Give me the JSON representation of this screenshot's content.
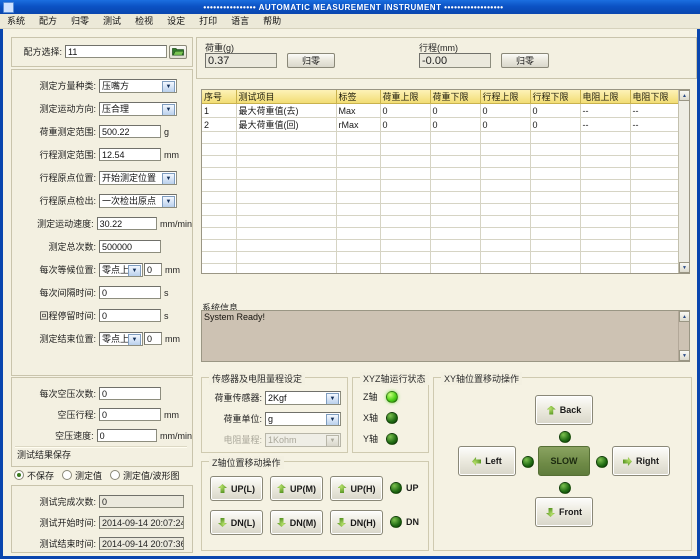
{
  "window": {
    "title": "••••••••••••••••  AUTOMATIC MEASUREMENT INSTRUMENT  ••••••••••••••••••",
    "icon": "app-icon"
  },
  "menu": {
    "items": [
      {
        "label": "系统"
      },
      {
        "label": "配方"
      },
      {
        "label": "归零"
      },
      {
        "label": "测试"
      },
      {
        "label": "检视"
      },
      {
        "label": "设定"
      },
      {
        "label": "打印"
      },
      {
        "label": "语言"
      },
      {
        "label": "帮助"
      }
    ]
  },
  "recipe": {
    "label": "配方选择:",
    "value": "11",
    "browse_icon": "folder-open-icon"
  },
  "params": {
    "rows": [
      {
        "label": "测定方量种类:",
        "value": "压嘴方",
        "type": "select",
        "unit": ""
      },
      {
        "label": "测定运动方向:",
        "value": "压合理",
        "type": "select",
        "unit": ""
      },
      {
        "label": "荷重测定范围:",
        "value": "500.22",
        "type": "input",
        "unit": "g"
      },
      {
        "label": "行程测定范围:",
        "value": "12.54",
        "type": "input",
        "unit": "mm"
      },
      {
        "label": "行程原点位置:",
        "value": "开始测定位置",
        "type": "select",
        "unit": ""
      },
      {
        "label": "行程原点检出:",
        "value": "一次检出原点",
        "type": "select",
        "unit": ""
      },
      {
        "label": "测定运动速度:",
        "value": "30.22",
        "type": "input",
        "unit": "mm/min"
      },
      {
        "label": "测定总次数:",
        "value": "500000",
        "type": "input",
        "unit": ""
      }
    ],
    "combo_rows": [
      {
        "label": "每次等候位置:",
        "select": "零点上方",
        "value": "0",
        "unit": "mm"
      },
      {
        "label": "测定结束位置:",
        "select": "零点上方",
        "value": "0",
        "unit": "mm"
      }
    ],
    "time_rows": [
      {
        "label": "每次间隔时间:",
        "value": "0",
        "unit": "s"
      },
      {
        "label": "回程停留时间:",
        "value": "0",
        "unit": "s"
      }
    ]
  },
  "air": {
    "rows": [
      {
        "label": "每次空压次数:",
        "value": "0",
        "unit": ""
      },
      {
        "label": "空压行程:",
        "value": "0",
        "unit": "mm"
      },
      {
        "label": "空压速度:",
        "value": "0",
        "unit": "mm/min"
      }
    ]
  },
  "save": {
    "title": "测试结果保存",
    "options": [
      {
        "label": "不保存",
        "selected": true
      },
      {
        "label": "测定值",
        "selected": false
      },
      {
        "label": "测定值/波形图",
        "selected": false
      }
    ]
  },
  "result": {
    "rows": [
      {
        "label": "测试完成次数:",
        "value": "0"
      },
      {
        "label": "测试开始时间:",
        "value": "2014-09-14 20:07:24"
      },
      {
        "label": "测试结束时间:",
        "value": "2014-09-14 20:07:36"
      }
    ]
  },
  "readouts": {
    "load": {
      "label": "荷重(g)",
      "value": "0.37",
      "button": "归零"
    },
    "stroke": {
      "label": "行程(mm)",
      "value": "-0.00",
      "button": "归零"
    }
  },
  "table": {
    "headers": [
      "序号",
      "测试项目",
      "标签",
      "荷重上限",
      "荷重下限",
      "行程上限",
      "行程下限",
      "电阻上限",
      "电阻下限"
    ],
    "rows": [
      [
        "1",
        "最大荷重值(去)",
        "Max",
        "0",
        "0",
        "0",
        "0",
        "--",
        "--"
      ],
      [
        "2",
        "最大荷重值(回)",
        "rMax",
        "0",
        "0",
        "0",
        "0",
        "--",
        "--"
      ]
    ],
    "empty_rows": 13,
    "scroll_up_icon": "scroll-up-icon",
    "scroll_down_icon": "scroll-down-icon"
  },
  "sysinfo": {
    "title": "系统信息",
    "text": "System Ready!",
    "scroll_up_icon": "scroll-up-icon",
    "scroll_down_icon": "scroll-down-icon"
  },
  "sensor": {
    "title": "传感器及电阻量程设定",
    "rows": [
      {
        "label": "荷重传感器:",
        "value": "2Kgf",
        "disabled": false
      },
      {
        "label": "荷重单位:",
        "value": "g",
        "disabled": false
      },
      {
        "label": "电阻量程:",
        "value": "1Kohm",
        "disabled": true
      }
    ]
  },
  "axisstatus": {
    "title": "XYZ轴运行状态",
    "items": [
      {
        "label": "Z轴",
        "state": "on"
      },
      {
        "label": "X轴",
        "state": "off"
      },
      {
        "label": "Y轴",
        "state": "off"
      }
    ]
  },
  "zaxis": {
    "title": "Z轴位置移动操作",
    "up_buttons": [
      {
        "label": "UP(L)"
      },
      {
        "label": "UP(M)"
      },
      {
        "label": "UP(H)"
      }
    ],
    "down_buttons": [
      {
        "label": "DN(L)"
      },
      {
        "label": "DN(M)"
      },
      {
        "label": "DN(H)"
      }
    ],
    "up_led": {
      "label": "UP",
      "state": "off"
    },
    "down_led": {
      "label": "DN",
      "state": "off"
    }
  },
  "xyaxis": {
    "title": "XY轴位置移动操作",
    "back": {
      "label": "Back"
    },
    "left": {
      "label": "Left"
    },
    "center": {
      "label": "SLOW"
    },
    "right": {
      "label": "Right"
    },
    "front": {
      "label": "Front"
    },
    "leds": [
      {
        "name": "back-led",
        "state": "off"
      },
      {
        "name": "left-led",
        "state": "off"
      },
      {
        "name": "right-led",
        "state": "off"
      },
      {
        "name": "front-led",
        "state": "off"
      }
    ]
  },
  "colors": {
    "titlebar": "#0a46ae",
    "body": "#f3f0e1",
    "header": "#f2dd74",
    "led_on": "#4ed318",
    "led_off": "#1f6a12",
    "center_button": "#6e8a46",
    "memo": "#cdc2b3"
  }
}
